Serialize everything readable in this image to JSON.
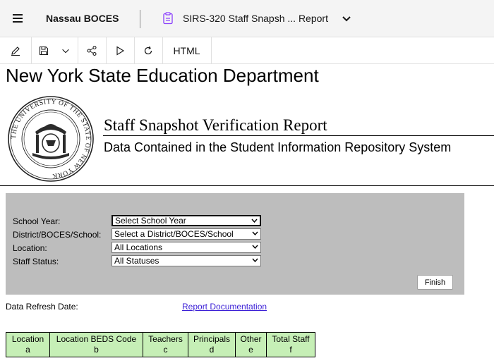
{
  "header": {
    "org_name": "Nassau BOCES",
    "report_title": "SIRS-320 Staff Snapsh ... Report"
  },
  "toolbar": {
    "output_format": "HTML"
  },
  "report": {
    "agency": "New York State Education Department",
    "title": "Staff Snapshot Verification Report",
    "subtitle": "Data Contained in the Student Information Repository System",
    "seal_text": "THE UNIVERSITY OF THE STATE OF NEW YORK"
  },
  "filters": {
    "school_year": {
      "label": "School Year:",
      "value": "Select School Year"
    },
    "district": {
      "label": "District/BOCES/School:",
      "value": "Select a District/BOCES/School"
    },
    "location": {
      "label": "Location:",
      "value": "All Locations"
    },
    "staff_status": {
      "label": "Staff Status:",
      "value": "All Statuses"
    },
    "finish_label": "Finish"
  },
  "refresh_label": "Data Refresh Date:",
  "doc_link": "Report Documentation",
  "table": {
    "columns": [
      {
        "name": "Location",
        "letter": "a"
      },
      {
        "name": "Location BEDS Code",
        "letter": "b"
      },
      {
        "name": "Teachers",
        "letter": "c"
      },
      {
        "name": "Principals",
        "letter": "d"
      },
      {
        "name": "Other",
        "letter": "e"
      },
      {
        "name": "Total Staff",
        "letter": "f"
      }
    ]
  },
  "colors": {
    "header_bg": "#f4f4f4",
    "filter_panel": "#bdbdbd",
    "table_header": "#c6efb6",
    "link": "#3b1fd6"
  },
  "icons": [
    "menu-icon",
    "report-icon",
    "chevron-down-icon",
    "edit-icon",
    "save-icon",
    "share-icon",
    "run-icon",
    "refresh-icon",
    "state-seal"
  ]
}
